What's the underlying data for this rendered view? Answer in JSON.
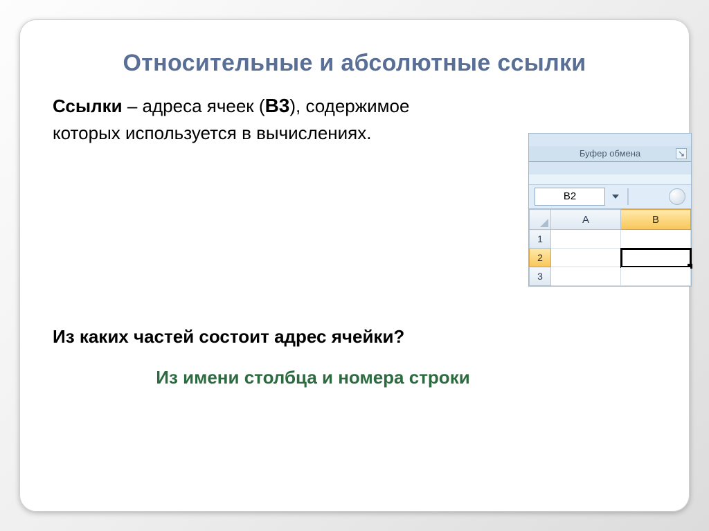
{
  "title": "Относительные и абсолютные ссылки",
  "def_prefix": "Ссылки",
  "def_mid": " – адреса ячеек (",
  "def_ref": "B3",
  "def_after": "), содержимое",
  "def_line2": "которых используется в вычислениях.",
  "question": "Из каких частей состоит адрес ячейки?",
  "answer": "Из имени столбца и номера строки",
  "excel": {
    "ribbon_group": "Буфер обмена",
    "namebox": "B2",
    "cols": [
      "A",
      "B"
    ],
    "rows": [
      "1",
      "2",
      "3"
    ],
    "active_cell": "B2"
  }
}
